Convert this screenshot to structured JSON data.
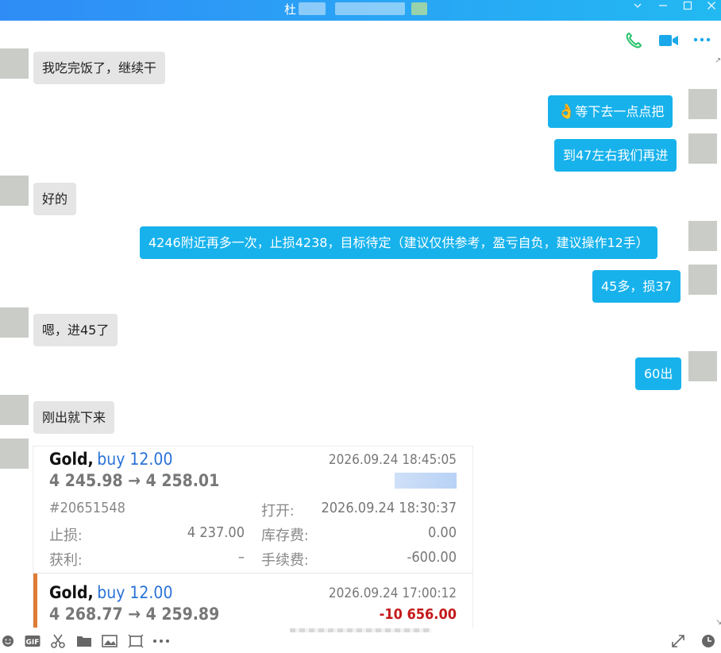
{
  "window": {
    "title": "杜",
    "controls": [
      "chevron-down-icon",
      "minimize-icon",
      "maximize-icon",
      "close-icon"
    ]
  },
  "header_actions": [
    "phone-icon",
    "video-call-icon",
    "more-icon"
  ],
  "messages": [
    {
      "side": "in",
      "text": "我吃完饭了，继续干"
    },
    {
      "side": "out",
      "emoji": "👌",
      "text": "等下去一点点把"
    },
    {
      "side": "out",
      "text": "到47左右我们再进"
    },
    {
      "side": "in",
      "text": "好的"
    },
    {
      "side": "out",
      "text": "4246附近再多一次，止损4238，目标待定（建议仅供参考，盈亏自负，建议操作12手）"
    },
    {
      "side": "out",
      "text": "45多，损37"
    },
    {
      "side": "in",
      "text": "嗯，进45了"
    },
    {
      "side": "out",
      "text": "60出"
    },
    {
      "side": "in",
      "text": "刚出就下来"
    }
  ],
  "trade_card": {
    "trade1": {
      "symbol": "Gold,",
      "side": "buy 12.00",
      "close_time": "2026.09.24 18:45:05",
      "prices": "4 245.98 → 4 258.01",
      "ticket": "#20651548",
      "open_label": "打开:",
      "open_time": "2026.09.24 18:30:37",
      "sl_label": "止损:",
      "sl_value": "4 237.00",
      "swap_label": "库存费:",
      "swap_value": "0.00",
      "tp_label": "获利:",
      "tp_value": "–",
      "fee_label": "手续费:",
      "fee_value": "-600.00"
    },
    "trade2": {
      "symbol": "Gold,",
      "side": "buy 12.00",
      "close_time": "2026.09.24 17:00:12",
      "prices": "4 268.77 → 4 259.89",
      "profit": "-10 656.00"
    }
  },
  "toolbar": [
    "emoji-icon",
    "gif-icon",
    "scissors-icon",
    "folder-icon",
    "image-icon",
    "screenshot-icon",
    "more-icon",
    "expand-icon",
    "history-icon"
  ],
  "colors": {
    "title_bar": "#2aa3f5",
    "outgoing": "#17b2ec",
    "incoming": "#e5e5e5",
    "buy": "#2a72d8",
    "loss": "#c41a1a",
    "accent_bar": "#e07b36"
  }
}
